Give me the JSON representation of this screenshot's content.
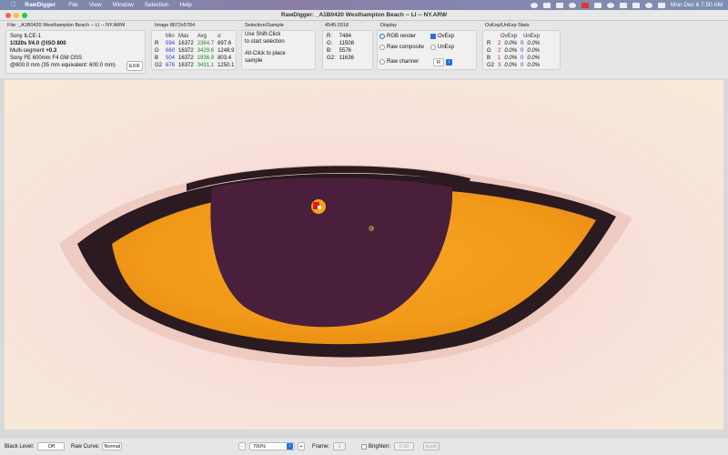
{
  "menubar": {
    "app": "RawDigger",
    "items": [
      "File",
      "View",
      "Window",
      "Selection",
      "Help"
    ],
    "clock": "Mon Dec 6  7:50 AM"
  },
  "window": {
    "title": "RawDigger: _A1B0420  Westhampton Beach -- LI -- NY.ARW"
  },
  "file_panel": {
    "header": "File: _A1B0420  Westhampton Beach -- LI -- NY.ARW",
    "camera": "Sony ILCE-1",
    "exposure": "1/320s f/4.0 @ISO 800",
    "metering_label": "Multi-segment",
    "metering_value": "+0.3",
    "lens": "Sony FE 600mm F4 GM OSS",
    "focal": "@600.0 mm (35 mm equivalent: 600.0 mm)",
    "exif_button": "EXIF"
  },
  "image_panel": {
    "header": "Image 8672x5784",
    "columns": [
      "Min",
      "Max",
      "Avg",
      "σ"
    ],
    "rows": [
      {
        "ch": "R",
        "min": "594",
        "max": "16372",
        "avg": "2364.7",
        "sd": "697.6"
      },
      {
        "ch": "G",
        "min": "660",
        "max": "16372",
        "avg": "3429.6",
        "sd": "1248.9"
      },
      {
        "ch": "B",
        "min": "504",
        "max": "16372",
        "avg": "1936.9",
        "sd": "803.4"
      },
      {
        "ch": "G2",
        "min": "676",
        "max": "16372",
        "avg": "3431.1",
        "sd": "1250.1"
      }
    ]
  },
  "selection_panel": {
    "header": "Selection/Sample",
    "hint1_a": "Use Shift-Click",
    "hint1_b": "to start selection",
    "hint2_a": "Alt-Click to place",
    "hint2_b": "sample"
  },
  "coord_panel": {
    "header": "4545:2018",
    "rows": [
      {
        "label": "R:",
        "value": "7484"
      },
      {
        "label": "G:",
        "value": "11508"
      },
      {
        "label": "B:",
        "value": "5576"
      },
      {
        "label": "G2:",
        "value": "11636"
      }
    ]
  },
  "display_panel": {
    "header": "Display",
    "rgb_render": "RGB render",
    "ovexp": "OvExp",
    "raw_composite": "Raw composite",
    "unexp": "UnExp",
    "raw_channel": "Raw channel",
    "channel_value": "R"
  },
  "ovexp_panel": {
    "header": "OvExp/UnExp Stats",
    "col_ov": "OvExp",
    "col_un": "UnExp",
    "rows": [
      {
        "ch": "R",
        "ov_n": "2",
        "ov_p": "0.0%",
        "un_n": "0",
        "un_p": "0.0%"
      },
      {
        "ch": "G",
        "ov_n": "2",
        "ov_p": "0.0%",
        "un_n": "0",
        "un_p": "0.0%"
      },
      {
        "ch": "B",
        "ov_n": "1",
        "ov_p": "0.0%",
        "un_n": "0",
        "un_p": "0.0%"
      },
      {
        "ch": "G2",
        "ov_n": "3",
        "ov_p": "0.0%",
        "un_n": "0",
        "un_p": "0.0%"
      }
    ]
  },
  "bottombar": {
    "black_level_label": "Black Level:",
    "black_level_value": "Off",
    "raw_curve_label": "Raw Curve:",
    "raw_curve_value": "Normal",
    "zoom_minus": "-",
    "zoom_value": "700%",
    "zoom_plus": "+",
    "frame_label": "Frame:",
    "frame_value": "1",
    "brighten_label": "Brighten:",
    "brighten_value": "0.00",
    "apply_label": "Apply"
  },
  "colors": {
    "iris": "#f29a1a",
    "pupil": "#4a1f3b",
    "eyelid": "#2b1a20",
    "skin": "#f8e2dc"
  }
}
